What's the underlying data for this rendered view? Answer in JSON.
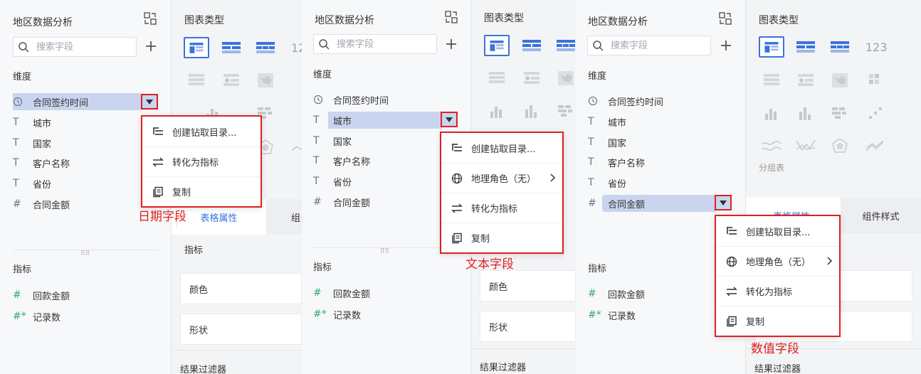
{
  "panel1": {
    "title": "地区数据分析",
    "search_placeholder": "搜索字段",
    "dimension_label": "维度",
    "dimensions": [
      {
        "type": "clock",
        "name": "合同签约时间"
      },
      {
        "type": "T",
        "name": "城市"
      },
      {
        "type": "T",
        "name": "国家"
      },
      {
        "type": "T",
        "name": "客户名称"
      },
      {
        "type": "T",
        "name": "省份"
      },
      {
        "type": "#",
        "name": "合同金额"
      }
    ],
    "metric_label": "指标",
    "metrics": [
      {
        "type": "#",
        "name": "回款金额"
      },
      {
        "type": "#*",
        "name": "记录数"
      }
    ],
    "menu": [
      {
        "icon": "drill-icon",
        "label": "创建钻取目录..."
      },
      {
        "icon": "convert-icon",
        "label": "转化为指标"
      },
      {
        "icon": "copy-icon",
        "label": "复制"
      }
    ],
    "annotation": "日期字段"
  },
  "charts1": {
    "title": "图表类型",
    "tab_table_attr": "表格属性",
    "tab_partial": "组",
    "metric_label": "指标",
    "color_label": "颜色",
    "shape_label": "形状",
    "filter_label": "结果过滤器",
    "icon_123": "12"
  },
  "panel2": {
    "title": "地区数据分析",
    "search_placeholder": "搜索字段",
    "dimension_label": "维度",
    "dimensions": [
      {
        "type": "clock",
        "name": "合同签约时间"
      },
      {
        "type": "T",
        "name": "城市"
      },
      {
        "type": "T",
        "name": "国家"
      },
      {
        "type": "T",
        "name": "客户名称"
      },
      {
        "type": "T",
        "name": "省份"
      },
      {
        "type": "#",
        "name": "合同金额"
      }
    ],
    "metric_label": "指标",
    "metrics": [
      {
        "type": "#",
        "name": "回款金额"
      },
      {
        "type": "#*",
        "name": "记录数"
      }
    ],
    "menu": [
      {
        "icon": "drill-icon",
        "label": "创建钻取目录..."
      },
      {
        "icon": "globe-icon",
        "label": "地理角色（无）"
      },
      {
        "icon": "convert-icon",
        "label": "转化为指标"
      },
      {
        "icon": "copy-icon",
        "label": "复制"
      }
    ],
    "annotation": "文本字段"
  },
  "charts2": {
    "title": "图表类型",
    "color_label": "颜色",
    "shape_label": "形状",
    "filter_label": "结果过滤器"
  },
  "panel3": {
    "title": "地区数据分析",
    "search_placeholder": "搜索字段",
    "dimension_label": "维度",
    "dimensions": [
      {
        "type": "clock",
        "name": "合同签约时间"
      },
      {
        "type": "T",
        "name": "城市"
      },
      {
        "type": "T",
        "name": "国家"
      },
      {
        "type": "T",
        "name": "客户名称"
      },
      {
        "type": "T",
        "name": "省份"
      },
      {
        "type": "#",
        "name": "合同金额"
      }
    ],
    "metric_label": "指标",
    "metrics": [
      {
        "type": "#",
        "name": "回款金额"
      },
      {
        "type": "#*",
        "name": "记录数"
      }
    ],
    "menu": [
      {
        "icon": "drill-icon",
        "label": "创建钻取目录..."
      },
      {
        "icon": "globe-icon",
        "label": "地理角色（无）"
      },
      {
        "icon": "convert-icon",
        "label": "转化为指标"
      },
      {
        "icon": "copy-icon",
        "label": "复制"
      }
    ],
    "annotation": "数值字段"
  },
  "charts3": {
    "title": "图表类型",
    "group_table_label": "分组表",
    "tab_table_attr": "表格属性",
    "tab_component_style": "组件样式",
    "filter_label": "结果过滤器",
    "icon_123": "123"
  },
  "colors": {
    "accent": "#3a73db",
    "selection": "#c9d5ef",
    "annotation_red": "#e02020",
    "icon_gray": "#6b7785"
  }
}
